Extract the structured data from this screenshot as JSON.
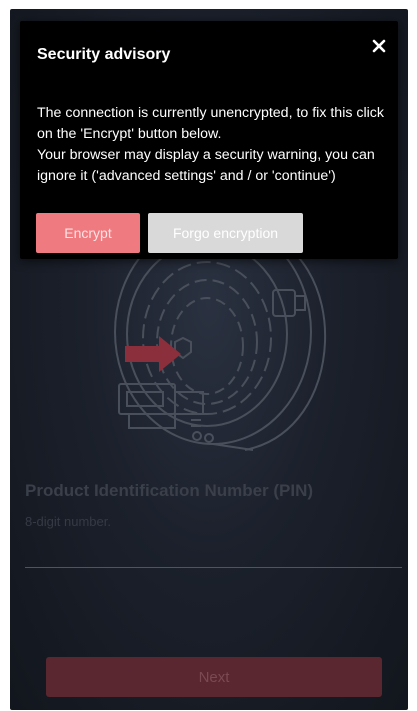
{
  "dialog": {
    "title": "Security advisory",
    "close_icon": "close-icon",
    "body_lines": [
      "The connection is currently unencrypted, to fix this click on the 'Encrypt' button below.",
      "Your browser may display a security warning, you can ignore it ('advanced settings' and / or 'continue')"
    ],
    "encrypt_label": "Encrypt",
    "forgo_label": "Forgo encryption"
  },
  "form": {
    "pin_label": "Product Identification Number (PIN)",
    "pin_hint": "8-digit number.",
    "pin_value": "",
    "next_label": "Next"
  },
  "colors": {
    "encrypt_button": "#ef7a80",
    "forgo_button": "#d9d9d9",
    "next_button_dimmed": "#5a2630",
    "arrow": "#8a2f3b"
  }
}
